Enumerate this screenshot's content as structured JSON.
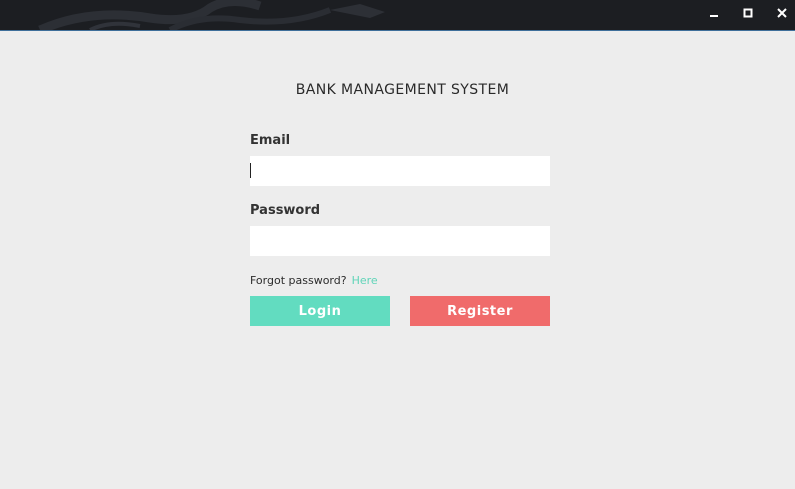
{
  "window": {
    "controls": {
      "minimize_icon": "minimize-icon",
      "maximize_icon": "maximize-icon",
      "close_icon": "close-icon"
    }
  },
  "login_form": {
    "title": "BANK MANAGEMENT SYSTEM",
    "email_label": "Email",
    "email_value": "",
    "password_label": "Password",
    "password_value": "",
    "forgot_text": "Forgot password?",
    "forgot_link": "Here",
    "login_button": "Login",
    "register_button": "Register"
  },
  "colors": {
    "login_button": "#62dcc0",
    "register_button": "#f06b6b",
    "link": "#5fd4b8",
    "background": "#ededed",
    "titlebar": "#1c1e22"
  }
}
